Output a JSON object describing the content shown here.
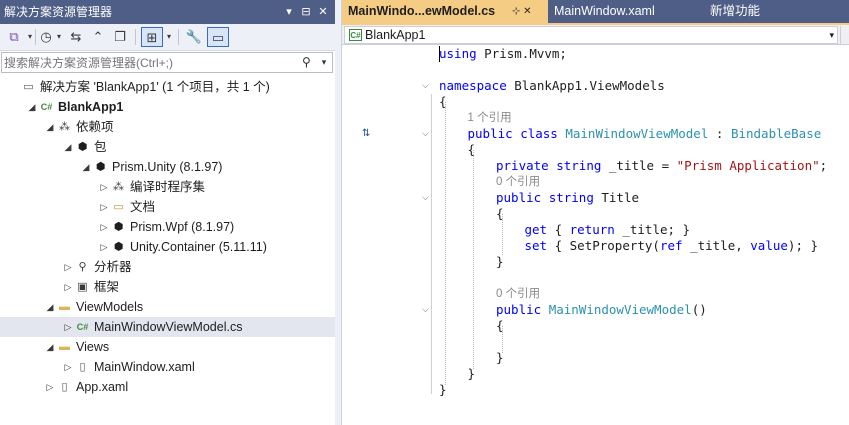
{
  "explorer": {
    "title": "解决方案资源管理器",
    "title_controls": [
      "▾",
      "⊟",
      "✕"
    ],
    "search": {
      "placeholder": "搜索解决方案资源管理器(Ctrl+;)"
    },
    "tree": [
      {
        "label": "解决方案 'BlankApp1' (1 个项目，共 1 个)",
        "arrow": "",
        "icon": "▭",
        "icon_color": "#5a5a5a"
      },
      {
        "label": "BlankApp1",
        "arrow": "◢",
        "icon": "C#",
        "icon_color": "#3d8a3d"
      },
      {
        "label": "依赖项",
        "arrow": "◢",
        "icon": "⁂",
        "icon_color": "#3a3a3a"
      },
      {
        "label": "包",
        "arrow": "◢",
        "icon": "⬢",
        "icon_color": "#1e1e1e"
      },
      {
        "label": "Prism.Unity (8.1.97)",
        "arrow": "◢",
        "icon": "⬢",
        "icon_color": "#1e1e1e"
      },
      {
        "label": "编译时程序集",
        "arrow": "▷",
        "icon": "⁂",
        "icon_color": "#3a3a3a"
      },
      {
        "label": "文档",
        "arrow": "▷",
        "icon": "▭",
        "icon_color": "#c8963c"
      },
      {
        "label": "Prism.Wpf (8.1.97)",
        "arrow": "▷",
        "icon": "⬢",
        "icon_color": "#1e1e1e"
      },
      {
        "label": "Unity.Container (5.11.11)",
        "arrow": "▷",
        "icon": "⬢",
        "icon_color": "#1e1e1e"
      },
      {
        "label": "分析器",
        "arrow": "▷",
        "icon": "⚲",
        "icon_color": "#3a3a3a"
      },
      {
        "label": "框架",
        "arrow": "▷",
        "icon": "▣",
        "icon_color": "#3a3a3a"
      },
      {
        "label": "ViewModels",
        "arrow": "◢",
        "icon": "▬",
        "icon_color": "#dcb45a"
      },
      {
        "label": "MainWindowViewModel.cs",
        "arrow": "▷",
        "icon": "C#",
        "icon_color": "#3d8a3d"
      },
      {
        "label": "Views",
        "arrow": "◢",
        "icon": "▬",
        "icon_color": "#dcb45a"
      },
      {
        "label": "MainWindow.xaml",
        "arrow": "▷",
        "icon": "▯",
        "icon_color": "#5a5a5a"
      },
      {
        "label": "App.xaml",
        "arrow": "▷",
        "icon": "▯",
        "icon_color": "#5a5a5a"
      }
    ]
  },
  "editor": {
    "tabs": [
      {
        "label": "MainWindo...ewModel.cs",
        "active": true,
        "close": "⊹ ✕"
      },
      {
        "label": "MainWindow.xaml",
        "active": false,
        "close": ""
      },
      {
        "label": "新增功能",
        "active": false,
        "close": ""
      }
    ],
    "nav_project": "BlankApp1",
    "code": [
      {
        "text": "using Prism.Mvvm;"
      },
      {
        "text": ""
      },
      {
        "text": "namespace BlankApp1.ViewModels"
      },
      {
        "text": "{"
      },
      {
        "text": "1 个引用"
      },
      {
        "text": "public class MainWindowViewModel : BindableBase"
      },
      {
        "text": "{"
      },
      {
        "text": "private string _title = \"Prism Application\";"
      },
      {
        "text": "0 个引用"
      },
      {
        "text": "public string Title"
      },
      {
        "text": "{"
      },
      {
        "text": "get { return _title; }"
      },
      {
        "text": "set { SetProperty(ref _title, value); }"
      },
      {
        "text": "}"
      },
      {
        "text": ""
      },
      {
        "text": "0 个引用"
      },
      {
        "text": "public MainWindowViewModel()"
      },
      {
        "text": "{"
      },
      {
        "text": ""
      },
      {
        "text": "}"
      },
      {
        "text": "}"
      },
      {
        "text": "}"
      }
    ]
  }
}
